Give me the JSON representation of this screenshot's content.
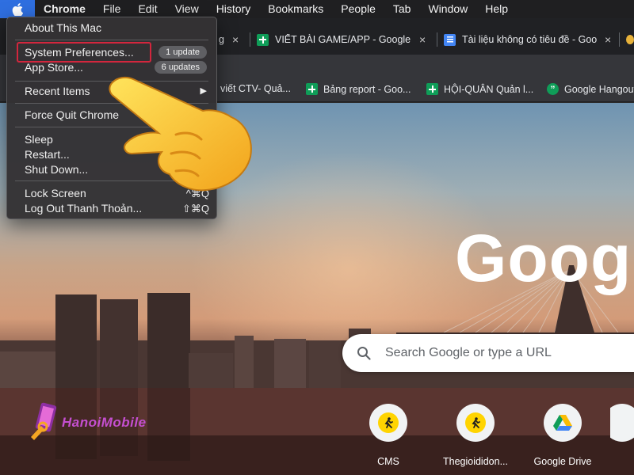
{
  "menubar": {
    "items": [
      "Chrome",
      "File",
      "Edit",
      "View",
      "History",
      "Bookmarks",
      "People",
      "Tab",
      "Window",
      "Help"
    ]
  },
  "apple_menu": {
    "about": "About This Mac",
    "system_prefs": "System Preferences...",
    "system_prefs_badge": "1 update",
    "app_store": "App Store...",
    "app_store_badge": "6 updates",
    "recent_items": "Recent Items",
    "force_quit": "Force Quit Chrome",
    "sleep": "Sleep",
    "restart": "Restart...",
    "shut_down": "Shut Down...",
    "lock_screen": "Lock Screen",
    "lock_screen_shortcut": "^⌘Q",
    "log_out": "Log Out Thanh Thoản...",
    "log_out_shortcut": "⇧⌘Q"
  },
  "tabs": [
    {
      "title": "g",
      "close": "×"
    },
    {
      "title": "VIẾT BÀI GAME/APP - Google",
      "close": "×"
    },
    {
      "title": "Tài liệu không có tiêu đề - Goo",
      "close": "×"
    }
  ],
  "bookmarks": [
    {
      "label": "viết CTV- Quả..."
    },
    {
      "label": "Bảng report - Goo..."
    },
    {
      "label": "HỘI-QUÂN Quản l..."
    },
    {
      "label": "Google Hangouts"
    }
  ],
  "newtab": {
    "logo": "Googl",
    "search_placeholder": "Search Google or type a URL",
    "shortcuts": [
      {
        "label": "CMS",
        "icon": "runner-icon"
      },
      {
        "label": "Thegioididon...",
        "icon": "runner-icon"
      },
      {
        "label": "Google Drive",
        "icon": "google-drive-icon"
      }
    ]
  },
  "watermark": {
    "text": "HanoiMobile"
  },
  "colors": {
    "highlight_box": "#d3263d",
    "apple_accent": "#2f6fe0"
  }
}
